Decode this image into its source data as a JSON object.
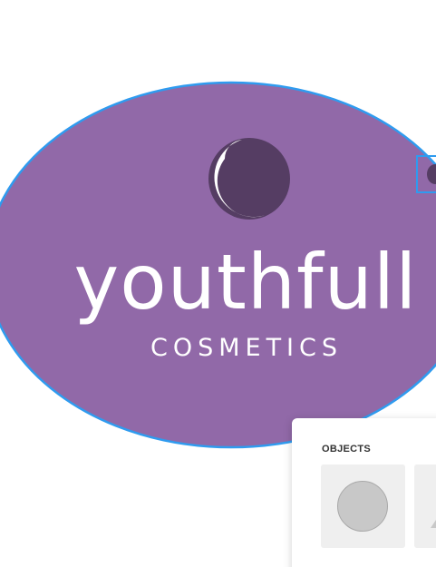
{
  "logo": {
    "name": "youthfull",
    "tagline": "COSMETICS"
  },
  "objects_panel": {
    "title": "OBJECTS",
    "items": [
      "circle",
      "triangle"
    ]
  },
  "colors": {
    "oval_fill": "#9169a8",
    "selection": "#2f9bef",
    "mark_dark": "#553d63",
    "text": "#ffffff"
  }
}
